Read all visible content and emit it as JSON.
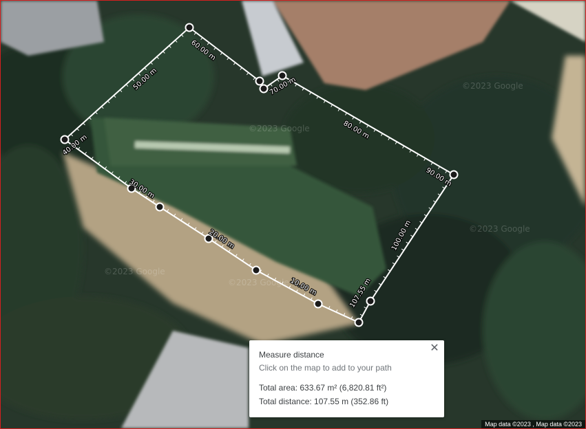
{
  "map": {
    "attribution": "Map data ©2023 , Map data ©2023",
    "watermark": "©2023 Google",
    "colors": {
      "vegetation": "#2f4a2c",
      "dark_vegetation": "#1f2d22",
      "lawn": "#35573a",
      "dirt": "#b9a88a",
      "roof": "#a07a63",
      "path_line": "#ffffff",
      "vertex_fill": "#1a1a1a"
    }
  },
  "measure_path": {
    "distance_labels": [
      "60.00 m",
      "50.00 m",
      "70.00 m",
      "80.00 m",
      "40.00 m",
      "90.00 m",
      "30.00 m",
      "100.00 m",
      "20.00 m",
      "10.00 m",
      "107.55 m"
    ]
  },
  "measure_card": {
    "title": "Measure distance",
    "hint": "Click on the map to add to your path",
    "total_area": "Total area: 633.67 m² (6,820.81 ft²)",
    "total_distance": "Total distance: 107.55 m (352.86 ft)",
    "close_icon": "close-icon"
  }
}
